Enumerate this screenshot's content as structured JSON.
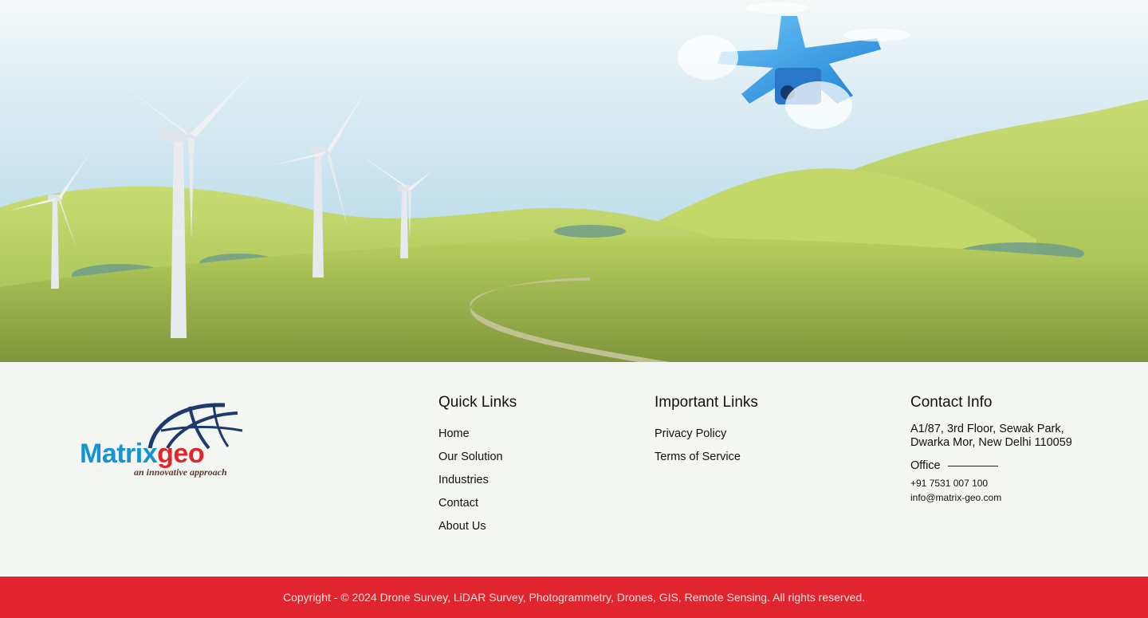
{
  "hero": {
    "icons": [
      "wind-turbine-icon",
      "drone-icon"
    ]
  },
  "logo": {
    "word_blue": "Matrix",
    "word_red": "geo",
    "tagline": "an innovative approach"
  },
  "quick_links": {
    "heading": "Quick Links",
    "items": [
      "Home",
      "Our Solution",
      "Industries",
      "Contact",
      "About Us"
    ]
  },
  "important_links": {
    "heading": "Important Links",
    "items": [
      "Privacy Policy",
      "Terms of Service"
    ]
  },
  "contact": {
    "heading": "Contact Info",
    "address_line1": "A1/87, 3rd Floor, Sewak Park,",
    "address_line2": "Dwarka Mor, New Delhi 110059",
    "office_label": "Office",
    "phone": "+91 7531 007 100",
    "email": "info@matrix-geo.com"
  },
  "copyright": "Copyright - © 2024 Drone Survey, LiDAR Survey, Photogrammetry, Drones, GIS, Remote Sensing. All rights reserved.",
  "colors": {
    "accent_red": "#e0252f",
    "logo_blue": "#1593d3",
    "logo_red": "#e0262c",
    "footer_bg": "#f4f6f2"
  }
}
